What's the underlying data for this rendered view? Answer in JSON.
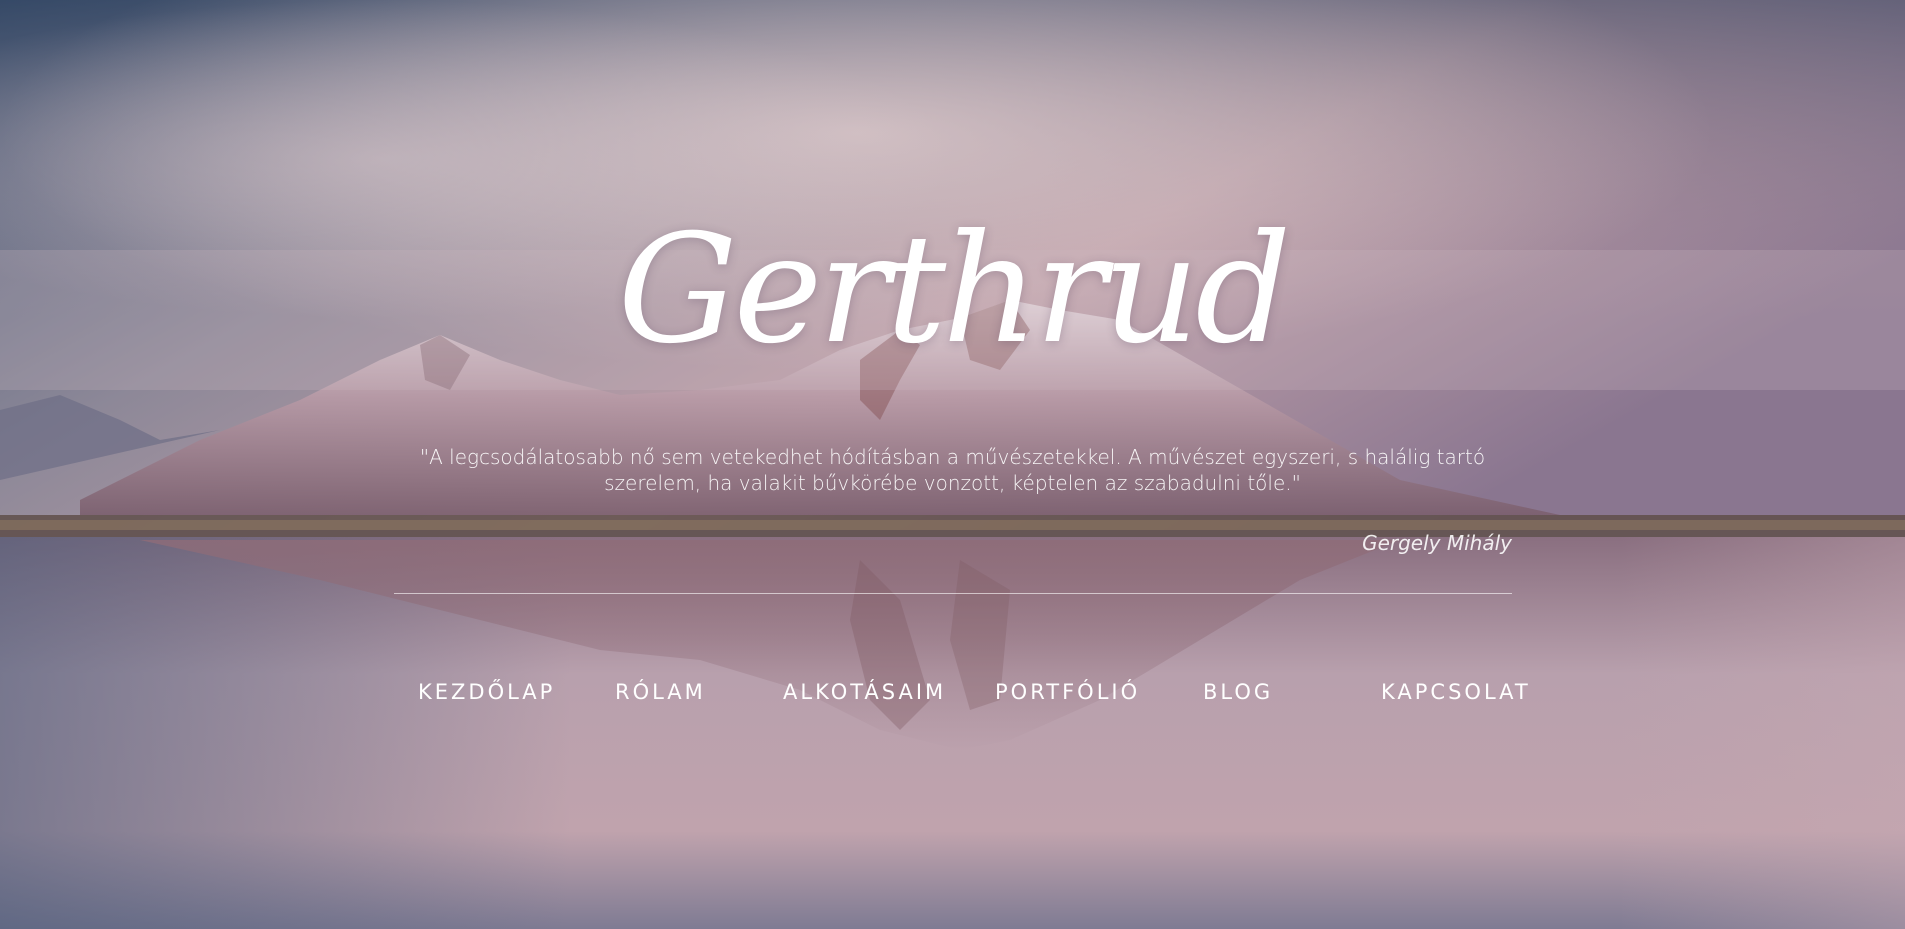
{
  "site": {
    "title": "Gerthrud"
  },
  "hero": {
    "quote": "\"A legcsodálatosabb nő sem vetekedhet hódításban a művészetekkel. A művészet egyszeri, s halálig tartó szerelem, ha valakit bűvkörébe vonzott, képtelen az szabadulni tőle.\"",
    "author": "Gergely Mihály"
  },
  "nav": {
    "items": [
      {
        "label": "KEZDŐLAP"
      },
      {
        "label": "RÓLAM"
      },
      {
        "label": "ALKOTÁSAIM"
      },
      {
        "label": "PORTFÓLIÓ"
      },
      {
        "label": "BLOG"
      },
      {
        "label": "KAPCSOLAT"
      }
    ]
  },
  "colors": {
    "sky_top": "#3f5674",
    "sky_pink": "#c7a4ab",
    "water": "#b795a1",
    "text": "#ffffff"
  }
}
